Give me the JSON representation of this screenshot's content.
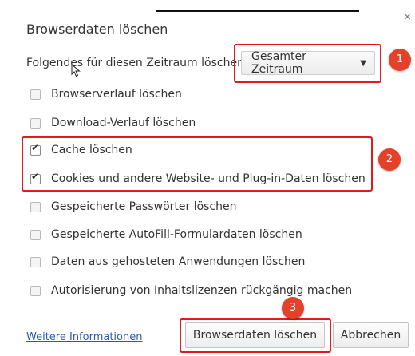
{
  "dialog": {
    "title": "Browserdaten löschen",
    "close_label": "×"
  },
  "range": {
    "label": "Folgendes für diesen Zeitraum löschen:",
    "selected": "Gesamter Zeitraum",
    "caret": "▼"
  },
  "options": [
    {
      "label": "Browserverlauf löschen",
      "checked": false
    },
    {
      "label": "Download-Verlauf löschen",
      "checked": false
    },
    {
      "label": "Cache löschen",
      "checked": true
    },
    {
      "label": "Cookies und andere Website- und Plug-in-Daten löschen",
      "checked": true
    },
    {
      "label": "Gespeicherte Passwörter löschen",
      "checked": false
    },
    {
      "label": "Gespeicherte AutoFill-Formulardaten löschen",
      "checked": false
    },
    {
      "label": "Daten aus gehosteten Anwendungen löschen",
      "checked": false
    },
    {
      "label": "Autorisierung von Inhaltslizenzen rückgängig machen",
      "checked": false
    }
  ],
  "check_mark": "✔",
  "footer": {
    "link_label": "Weitere Informationen",
    "clear_button_label": "Browserdaten löschen",
    "cancel_button_label": "Abbrechen"
  },
  "annotations": {
    "badge_1": "1",
    "badge_2": "2",
    "badge_3": "3",
    "highlight_color": "#e3191c",
    "badge_color": "#e4402a"
  }
}
